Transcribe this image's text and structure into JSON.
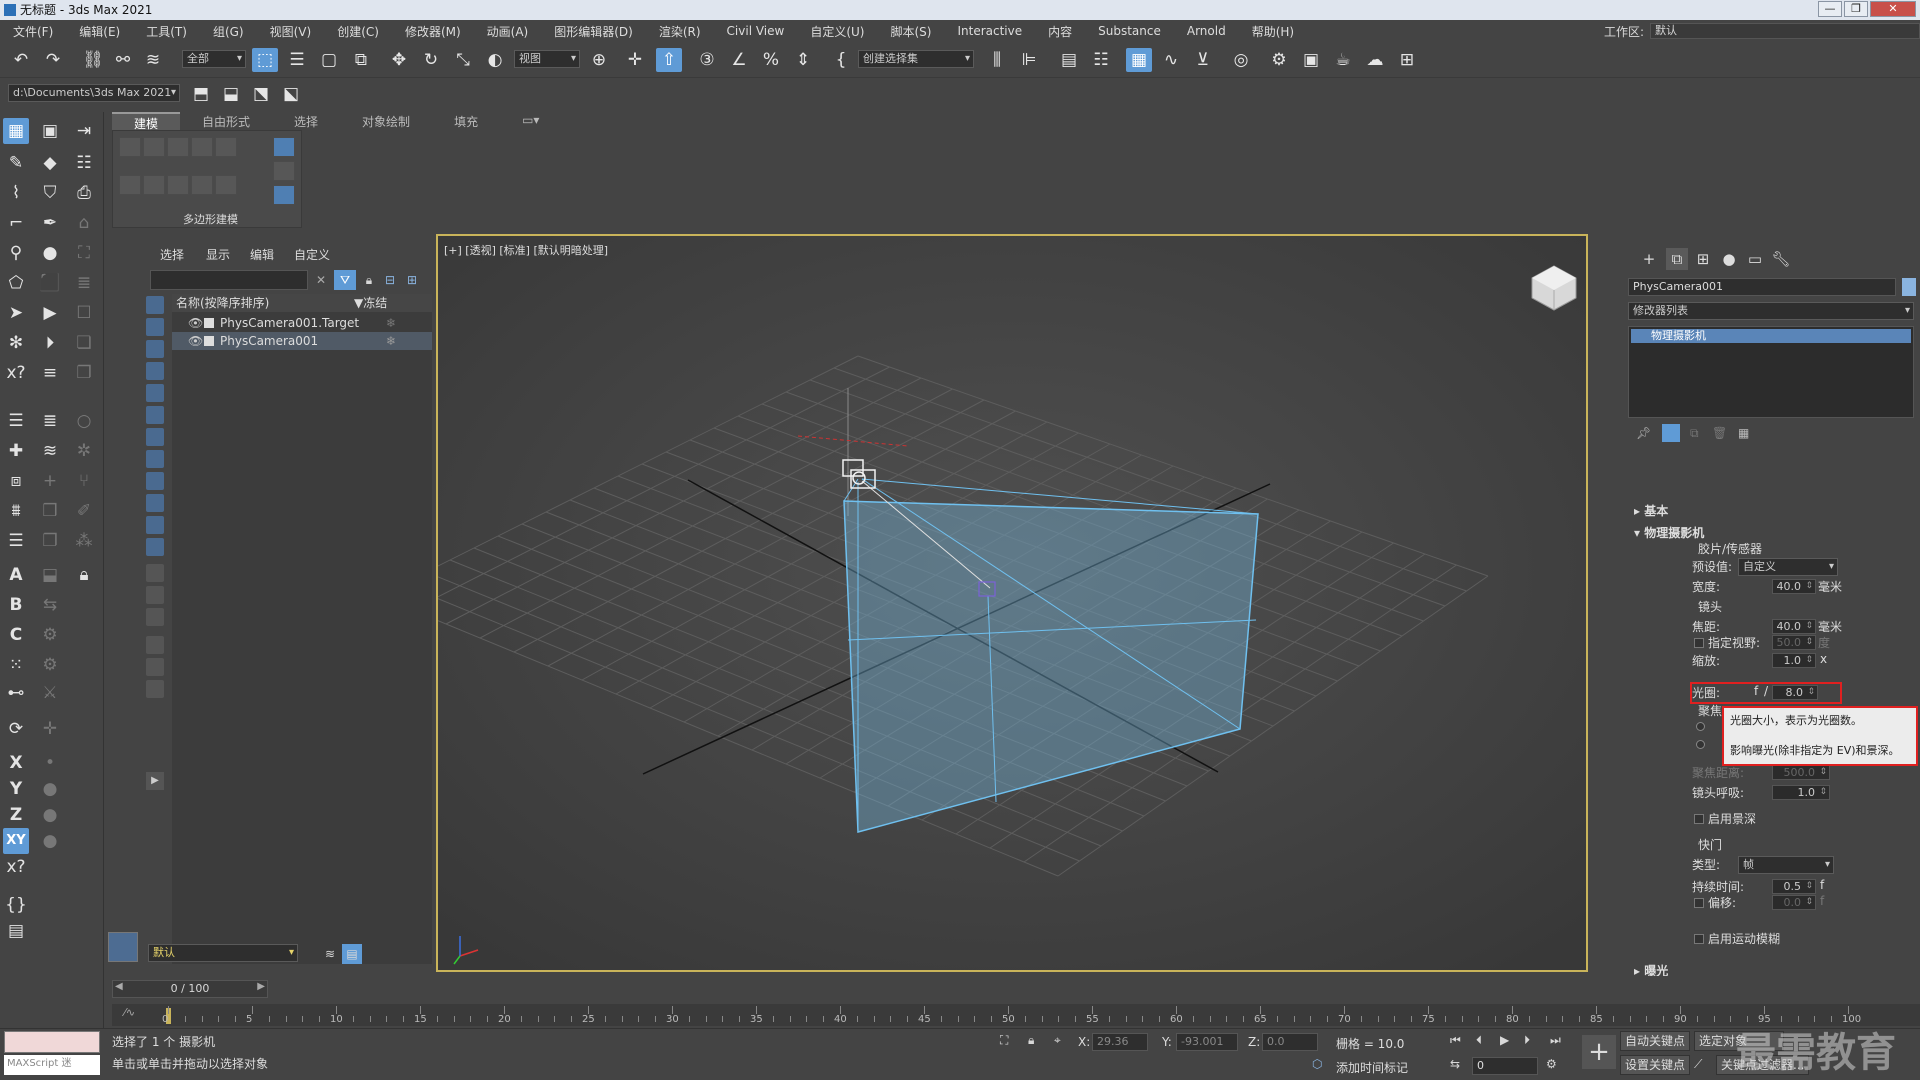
{
  "app": {
    "title": "无标题 - 3ds Max 2021",
    "workspace_label": "工作区:",
    "workspace_value": "默认"
  },
  "menus": [
    "文件(F)",
    "编辑(E)",
    "工具(T)",
    "组(G)",
    "视图(V)",
    "创建(C)",
    "修改器(M)",
    "动画(A)",
    "图形编辑器(D)",
    "渲染(R)",
    "Civil View",
    "自定义(U)",
    "脚本(S)",
    "Interactive",
    "内容",
    "Substance",
    "Arnold",
    "帮助(H)"
  ],
  "toolbar": {
    "selection_filter": "全部",
    "ref_coord": "视图",
    "named_selection": "创建选择集",
    "project_path": "d:\\Documents\\3ds Max 2021"
  },
  "ribbon": {
    "tabs": [
      "建模",
      "自由形式",
      "选择",
      "对象绘制",
      "填充"
    ],
    "active": "建模",
    "panel_label": "多边形建模"
  },
  "scene_explorer": {
    "tabs": [
      "选择",
      "显示",
      "编辑",
      "自定义"
    ],
    "col_name": "名称(按降序排序)",
    "col_frozen": "▼冻结",
    "rows": [
      {
        "name": "PhysCamera001.Target",
        "selected": false
      },
      {
        "name": "PhysCamera001",
        "selected": true
      }
    ],
    "layer": "默认"
  },
  "viewport": {
    "label": "[+] [透视] [标准] [默认明暗处理]"
  },
  "command_panel": {
    "object_name": "PhysCamera001",
    "modifier_list": "修改器列表",
    "stack_item": "物理摄影机",
    "rollout_basic": "基本",
    "rollout_phys": "物理摄影机",
    "film_group": "胶片/传感器",
    "preset_label": "预设值:",
    "preset_value": "自定义",
    "width_label": "宽度:",
    "width_value": "40.0",
    "mm": "毫米",
    "lens_group": "镜头",
    "focal_label": "焦距:",
    "focal_value": "40.0",
    "fov_label": "指定视野:",
    "fov_value": "50.0",
    "degree": "度",
    "zoom_label": "缩放:",
    "zoom_value": "1.0",
    "zoom_unit": "x",
    "aperture_label": "光圈:",
    "aperture_f": "f",
    "aperture_slash": "/",
    "aperture_value": "8.0",
    "focus_group": "聚焦",
    "focus_distance_label": "聚焦距离:",
    "focus_distance_value": "500.0",
    "breathing_label": "镜头呼吸:",
    "breathing_value": "1.0",
    "dof_label": "启用景深",
    "shutter_group": "快门",
    "type_label": "类型:",
    "type_value": "帧",
    "duration_label": "持续时间:",
    "duration_value": "0.5",
    "duration_unit": "f",
    "offset_label": "偏移:",
    "offset_value": "0.0",
    "offset_unit": "f",
    "motion_blur_label": "启用运动模糊",
    "next_rollout": "曝光"
  },
  "tooltip": {
    "line1": "光圈大小，表示为光圈数。",
    "line2": "影响曝光(除非指定为 EV)和景深。"
  },
  "timeline": {
    "frame": "0 / 100",
    "ticks": [
      "0",
      "5",
      "10",
      "15",
      "20",
      "25",
      "30",
      "35",
      "40",
      "45",
      "50",
      "55",
      "60",
      "65",
      "70",
      "75",
      "80",
      "85",
      "90",
      "95",
      "100"
    ]
  },
  "status": {
    "maxscript": "MAXScript 迷",
    "line1": "选择了 1 个 摄影机",
    "line2": "单击或单击并拖动以选择对象",
    "x_label": "X:",
    "x_value": "29.36",
    "y_label": "Y:",
    "y_value": "-93.001",
    "z_label": "Z:",
    "z_value": "0.0",
    "grid": "栅格 = 10.0",
    "add_time_tag": "添加时间标记",
    "auto_key": "自动关键点",
    "set_key": "设置关键点",
    "selected_obj": "选定对象",
    "key_filters": "关键点过滤器...",
    "frame_field": "0"
  },
  "watermark": "最需教育"
}
